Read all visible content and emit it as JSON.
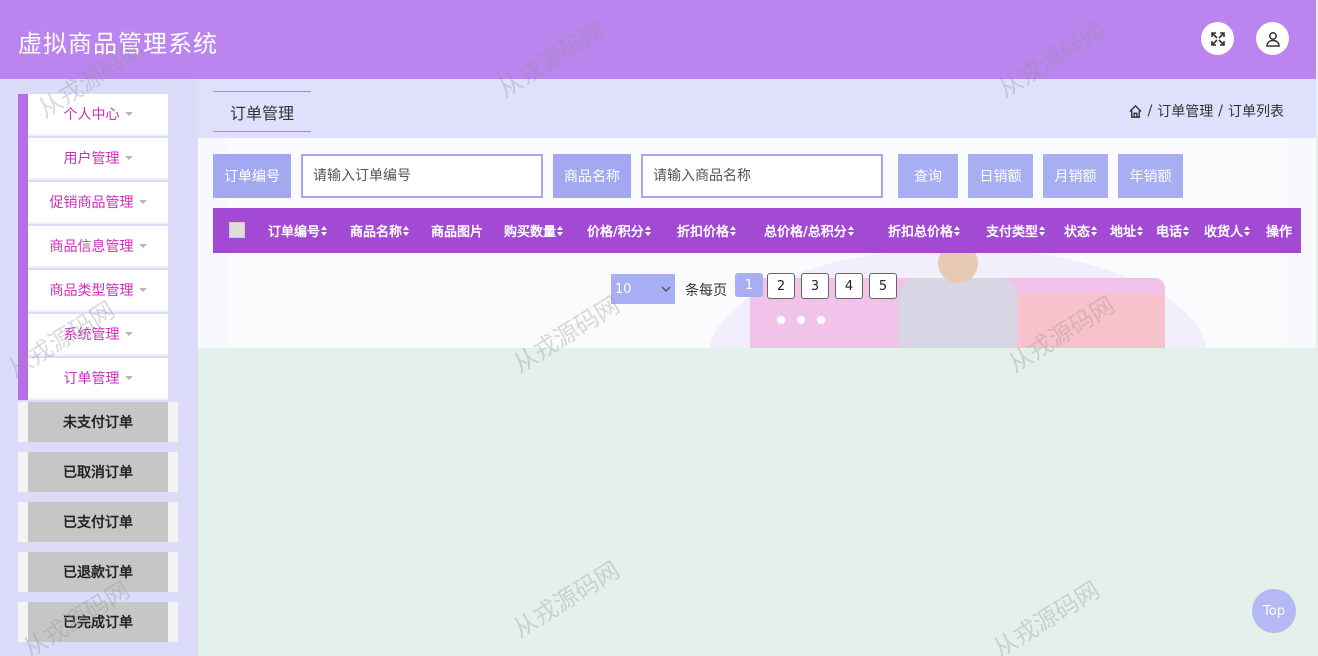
{
  "header": {
    "title": "虚拟商品管理系统"
  },
  "sidebar": {
    "menus": [
      {
        "label": "个人中心"
      },
      {
        "label": "用户管理"
      },
      {
        "label": "促销商品管理"
      },
      {
        "label": "商品信息管理"
      },
      {
        "label": "商品类型管理"
      },
      {
        "label": "系统管理"
      },
      {
        "label": "订单管理"
      }
    ],
    "sub_items": [
      {
        "label": "未支付订单"
      },
      {
        "label": "已取消订单"
      },
      {
        "label": "已支付订单"
      },
      {
        "label": "已退款订单"
      },
      {
        "label": "已完成订单"
      }
    ]
  },
  "page": {
    "tab_title": "订单管理",
    "breadcrumb": [
      "订单管理",
      "订单列表"
    ],
    "breadcrumb_sep": "/"
  },
  "search": {
    "order_no_label": "订单编号",
    "order_no_placeholder": "请输入订单编号",
    "goods_name_label": "商品名称",
    "goods_name_placeholder": "请输入商品名称",
    "buttons": [
      "查询",
      "日销额",
      "月销额",
      "年销额"
    ]
  },
  "table": {
    "columns": [
      "订单编号",
      "商品名称",
      "商品图片",
      "购买数量",
      "价格/积分",
      "折扣价格",
      "总价格/总积分",
      "折扣总价格",
      "支付类型",
      "状态",
      "地址",
      "电话",
      "收货人",
      "操作"
    ]
  },
  "pagination": {
    "page_size": "10",
    "per_page_label": "条每页",
    "pages": [
      "1",
      "2",
      "3",
      "4",
      "5"
    ],
    "current_page": "1"
  },
  "back_to_top": "Top",
  "watermark": "从戎源码网",
  "colors": {
    "header": "#bb84ee",
    "table_head": "#a24ad4",
    "button": "#a7aef2",
    "menu_text": "#cc2fb9"
  }
}
